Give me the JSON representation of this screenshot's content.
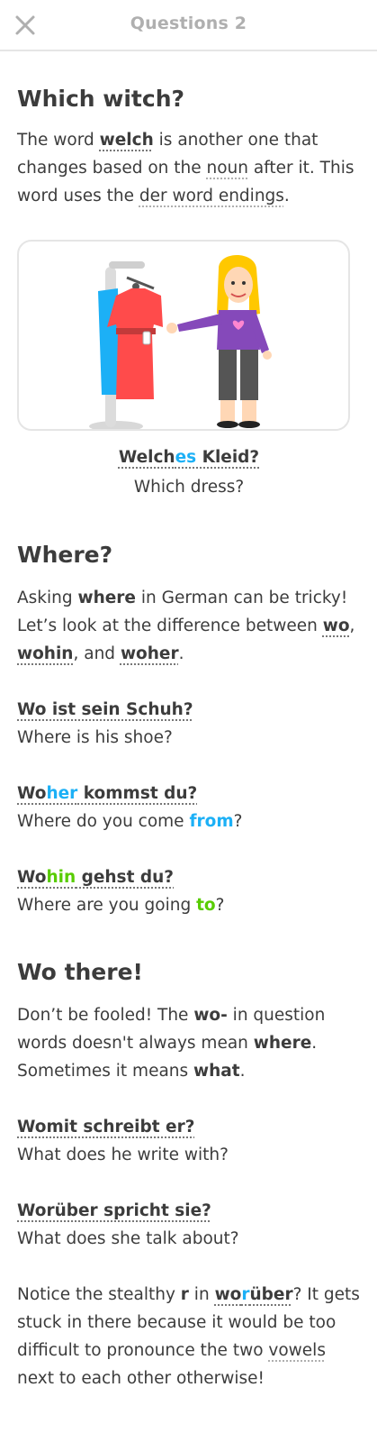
{
  "header": {
    "title": "Questions 2",
    "close_icon": "close-icon"
  },
  "sections": {
    "which": {
      "heading": "Which witch?",
      "p1_a": "The word ",
      "p1_welch": "welch",
      "p1_b": " is another one that changes based on the ",
      "p1_noun": "noun",
      "p1_c": " after it. This word uses the ",
      "p1_der": "der word endings",
      "p1_d": ".",
      "caption_de_a": "Welch",
      "caption_de_b": "es",
      "caption_de_c": " Kleid?",
      "caption_en": "Which dress?"
    },
    "where": {
      "heading": "Where?",
      "p_a": "Asking ",
      "p_where": "where",
      "p_b": " in German can be tricky! Let’s look at the difference between ",
      "p_wo": "wo",
      "p_c": ", ",
      "p_wohin": "wohin",
      "p_d": ", and ",
      "p_woher": "woher",
      "p_e": ".",
      "ex1_de": "Wo ist sein Schuh?",
      "ex1_en": "Where is his shoe?",
      "ex2_de_a": "Wo",
      "ex2_de_b": "her",
      "ex2_de_c": " kommst du?",
      "ex2_en_a": "Where do you come ",
      "ex2_en_b": "from",
      "ex2_en_c": "?",
      "ex3_de_a": "Wo",
      "ex3_de_b": "hin",
      "ex3_de_c": " gehst du?",
      "ex3_en_a": "Where are you going ",
      "ex3_en_b": "to",
      "ex3_en_c": "?"
    },
    "wothere": {
      "heading": "Wo there!",
      "p_a": "Don’t be fooled! The ",
      "p_wo": "wo-",
      "p_b": " in question words doesn't always mean ",
      "p_where": "where",
      "p_c": ". Sometimes it means ",
      "p_what": "what",
      "p_d": ".",
      "ex1_de": "Womit schreibt er?",
      "ex1_en": "What does he write with?",
      "ex2_de": "Worüber spricht sie?",
      "ex2_en": "What does she talk about?",
      "n_a": "Notice the stealthy ",
      "n_r": "r",
      "n_b": " in ",
      "n_wo1": "wo",
      "n_r2": "r",
      "n_wo2": "über",
      "n_c": "? It gets stuck in there because it would be too difficult to pronounce the two ",
      "n_vowels": "vowels",
      "n_d": " next to each other otherwise!"
    }
  },
  "colors": {
    "accent_blue": "#1cb0f6",
    "accent_green": "#58cc02",
    "text": "#3c3c3c",
    "muted": "#afafaf"
  }
}
